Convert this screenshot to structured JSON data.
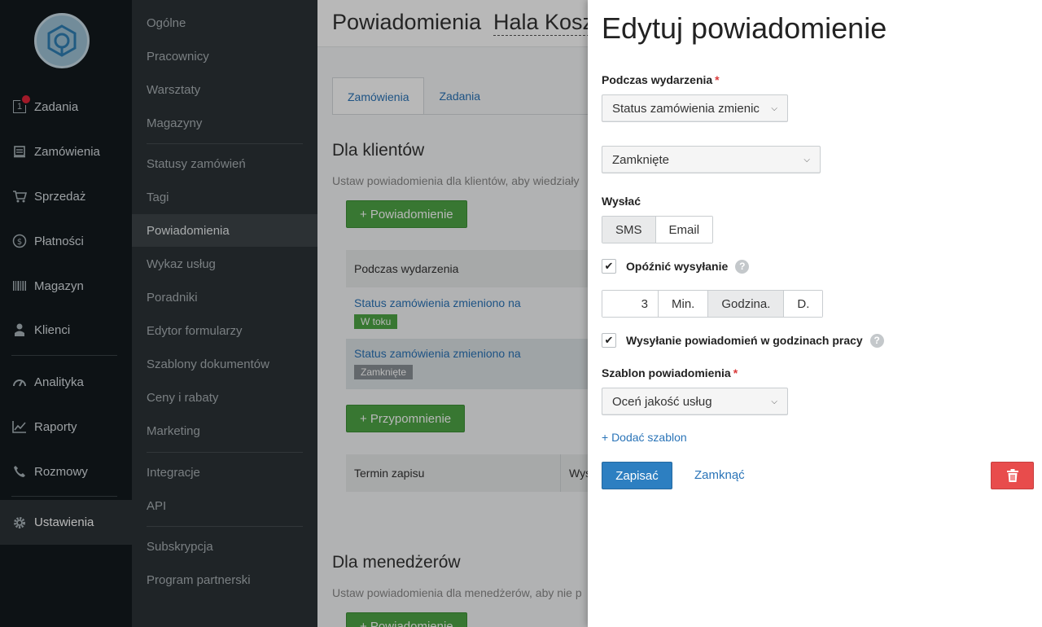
{
  "nav": {
    "items": [
      {
        "label": "Zadania",
        "icon": "tasks-icon"
      },
      {
        "label": "Zamówienia",
        "icon": "orders-icon"
      },
      {
        "label": "Sprzedaż",
        "icon": "cart-icon"
      },
      {
        "label": "Płatności",
        "icon": "dollar-icon"
      },
      {
        "label": "Magazyn",
        "icon": "barcode-icon"
      },
      {
        "label": "Klienci",
        "icon": "user-icon"
      },
      {
        "label": "Analityka",
        "icon": "gauge-icon"
      },
      {
        "label": "Raporty",
        "icon": "chart-icon"
      },
      {
        "label": "Rozmowy",
        "icon": "phone-icon"
      },
      {
        "label": "Ustawienia",
        "icon": "gear-icon"
      }
    ],
    "tasks_count": "1"
  },
  "subnav": {
    "items": [
      "Ogólne",
      "Pracownicy",
      "Warsztaty",
      "Magazyny",
      "Statusy zamówień",
      "Tagi",
      "Powiadomienia",
      "Wykaz usług",
      "Poradniki",
      "Edytor formularzy",
      "Szablony dokumentów",
      "Ceny i rabaty",
      "Marketing",
      "Integracje",
      "API",
      "Subskrypcja",
      "Program partnerski"
    ]
  },
  "main": {
    "title": "Powiadomienia",
    "location": "Hala Kosz",
    "tabs": [
      "Zamówienia",
      "Zadania"
    ],
    "clients": {
      "title": "Dla klientów",
      "desc": "Ustaw powiadomienia dla klientów, aby wiedziały",
      "add_button": "+ Powiadomienie",
      "table_header": "Podczas wydarzenia",
      "rows": [
        {
          "text": "Status zamówienia zmieniono na",
          "tag": "W toku"
        },
        {
          "text": "Status zamówienia zmieniono na",
          "tag": "Zamknięte"
        }
      ],
      "reminder_button": "+ Przypomnienie",
      "reminder_header_1": "Termin zapisu",
      "reminder_header_2": "Wys"
    },
    "managers": {
      "title": "Dla menedżerów",
      "desc": "Ustaw powiadomienia dla menedżerów, aby nie p",
      "add_button": "+ Powiadomienie"
    }
  },
  "drawer": {
    "title": "Edytuj powiadomienie",
    "event_label": "Podczas wydarzenia",
    "event_value": "Status zamówienia zmienic",
    "status_value": "Zamknięte",
    "send_label": "Wysłać",
    "send_options": [
      "SMS",
      "Email"
    ],
    "delay_label": "Opóźnić wysyłanie",
    "delay_value": "3",
    "delay_units": [
      "Min.",
      "Godzina.",
      "D."
    ],
    "work_hours_label": "Wysyłanie powiadomień w godzinach pracy",
    "template_label": "Szablon powiadomienia",
    "template_value": "Oceń jakość usług",
    "add_template": "+ Dodać szablon",
    "save": "Zapisać",
    "close": "Zamknąć",
    "help": "?",
    "check": "✔"
  }
}
